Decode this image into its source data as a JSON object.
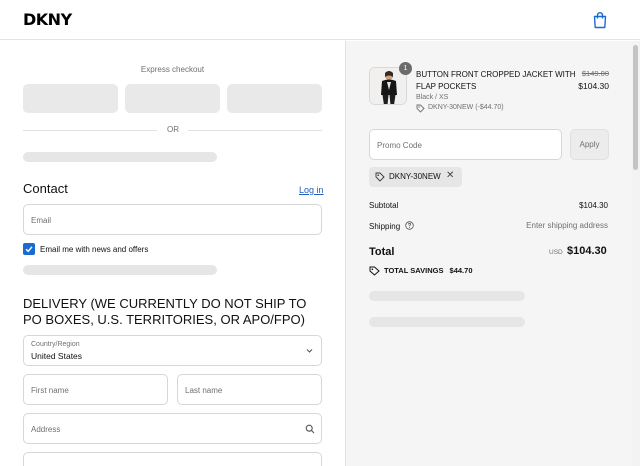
{
  "header": {
    "logo": "DKNY"
  },
  "express": {
    "label": "Express checkout",
    "or": "OR"
  },
  "contact": {
    "title": "Contact",
    "login": "Log in",
    "email_placeholder": "Email",
    "newsletter_label": "Email me with news and offers",
    "newsletter_checked": true
  },
  "delivery": {
    "title": "DELIVERY (WE CURRENTLY DO NOT SHIP TO PO BOXES, U.S. TERRITORIES, OR APO/FPO)",
    "country_label": "Country/Region",
    "country_value": "United States",
    "first_name_placeholder": "First name",
    "last_name_placeholder": "Last name",
    "address_placeholder": "Address"
  },
  "summary": {
    "product": {
      "quantity": "1",
      "name": "BUTTON FRONT CROPPED JACKET WITH FLAP POCKETS",
      "variant": "Black / XS",
      "discount": "DKNY-30NEW (-$44.70)",
      "price_original": "$149.00",
      "price_final": "$104.30"
    },
    "promo_placeholder": "Promo Code",
    "apply_label": "Apply",
    "applied_code": "DKNY-30NEW",
    "subtotal_label": "Subtotal",
    "subtotal_value": "$104.30",
    "shipping_label": "Shipping",
    "shipping_value": "Enter shipping address",
    "total_label": "Total",
    "total_currency": "USD",
    "total_value": "$104.30",
    "savings_label": "TOTAL SAVINGS",
    "savings_value": "$44.70"
  },
  "colors": {
    "accent": "#1a6bd1",
    "summary_bg": "#f5f5f5",
    "skeleton": "#e6e6e6"
  }
}
